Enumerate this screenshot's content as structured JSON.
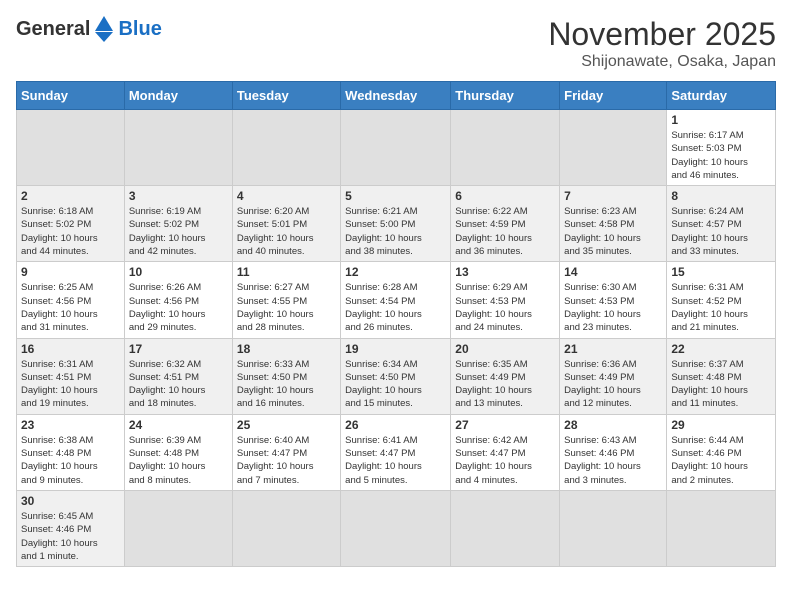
{
  "logo": {
    "general": "General",
    "blue": "Blue"
  },
  "title": "November 2025",
  "location": "Shijonawate, Osaka, Japan",
  "days_of_week": [
    "Sunday",
    "Monday",
    "Tuesday",
    "Wednesday",
    "Thursday",
    "Friday",
    "Saturday"
  ],
  "weeks": [
    [
      {
        "day": "",
        "info": ""
      },
      {
        "day": "",
        "info": ""
      },
      {
        "day": "",
        "info": ""
      },
      {
        "day": "",
        "info": ""
      },
      {
        "day": "",
        "info": ""
      },
      {
        "day": "",
        "info": ""
      },
      {
        "day": "1",
        "info": "Sunrise: 6:17 AM\nSunset: 5:03 PM\nDaylight: 10 hours\nand 46 minutes."
      }
    ],
    [
      {
        "day": "2",
        "info": "Sunrise: 6:18 AM\nSunset: 5:02 PM\nDaylight: 10 hours\nand 44 minutes."
      },
      {
        "day": "3",
        "info": "Sunrise: 6:19 AM\nSunset: 5:02 PM\nDaylight: 10 hours\nand 42 minutes."
      },
      {
        "day": "4",
        "info": "Sunrise: 6:20 AM\nSunset: 5:01 PM\nDaylight: 10 hours\nand 40 minutes."
      },
      {
        "day": "5",
        "info": "Sunrise: 6:21 AM\nSunset: 5:00 PM\nDaylight: 10 hours\nand 38 minutes."
      },
      {
        "day": "6",
        "info": "Sunrise: 6:22 AM\nSunset: 4:59 PM\nDaylight: 10 hours\nand 36 minutes."
      },
      {
        "day": "7",
        "info": "Sunrise: 6:23 AM\nSunset: 4:58 PM\nDaylight: 10 hours\nand 35 minutes."
      },
      {
        "day": "8",
        "info": "Sunrise: 6:24 AM\nSunset: 4:57 PM\nDaylight: 10 hours\nand 33 minutes."
      }
    ],
    [
      {
        "day": "9",
        "info": "Sunrise: 6:25 AM\nSunset: 4:56 PM\nDaylight: 10 hours\nand 31 minutes."
      },
      {
        "day": "10",
        "info": "Sunrise: 6:26 AM\nSunset: 4:56 PM\nDaylight: 10 hours\nand 29 minutes."
      },
      {
        "day": "11",
        "info": "Sunrise: 6:27 AM\nSunset: 4:55 PM\nDaylight: 10 hours\nand 28 minutes."
      },
      {
        "day": "12",
        "info": "Sunrise: 6:28 AM\nSunset: 4:54 PM\nDaylight: 10 hours\nand 26 minutes."
      },
      {
        "day": "13",
        "info": "Sunrise: 6:29 AM\nSunset: 4:53 PM\nDaylight: 10 hours\nand 24 minutes."
      },
      {
        "day": "14",
        "info": "Sunrise: 6:30 AM\nSunset: 4:53 PM\nDaylight: 10 hours\nand 23 minutes."
      },
      {
        "day": "15",
        "info": "Sunrise: 6:31 AM\nSunset: 4:52 PM\nDaylight: 10 hours\nand 21 minutes."
      }
    ],
    [
      {
        "day": "16",
        "info": "Sunrise: 6:31 AM\nSunset: 4:51 PM\nDaylight: 10 hours\nand 19 minutes."
      },
      {
        "day": "17",
        "info": "Sunrise: 6:32 AM\nSunset: 4:51 PM\nDaylight: 10 hours\nand 18 minutes."
      },
      {
        "day": "18",
        "info": "Sunrise: 6:33 AM\nSunset: 4:50 PM\nDaylight: 10 hours\nand 16 minutes."
      },
      {
        "day": "19",
        "info": "Sunrise: 6:34 AM\nSunset: 4:50 PM\nDaylight: 10 hours\nand 15 minutes."
      },
      {
        "day": "20",
        "info": "Sunrise: 6:35 AM\nSunset: 4:49 PM\nDaylight: 10 hours\nand 13 minutes."
      },
      {
        "day": "21",
        "info": "Sunrise: 6:36 AM\nSunset: 4:49 PM\nDaylight: 10 hours\nand 12 minutes."
      },
      {
        "day": "22",
        "info": "Sunrise: 6:37 AM\nSunset: 4:48 PM\nDaylight: 10 hours\nand 11 minutes."
      }
    ],
    [
      {
        "day": "23",
        "info": "Sunrise: 6:38 AM\nSunset: 4:48 PM\nDaylight: 10 hours\nand 9 minutes."
      },
      {
        "day": "24",
        "info": "Sunrise: 6:39 AM\nSunset: 4:48 PM\nDaylight: 10 hours\nand 8 minutes."
      },
      {
        "day": "25",
        "info": "Sunrise: 6:40 AM\nSunset: 4:47 PM\nDaylight: 10 hours\nand 7 minutes."
      },
      {
        "day": "26",
        "info": "Sunrise: 6:41 AM\nSunset: 4:47 PM\nDaylight: 10 hours\nand 5 minutes."
      },
      {
        "day": "27",
        "info": "Sunrise: 6:42 AM\nSunset: 4:47 PM\nDaylight: 10 hours\nand 4 minutes."
      },
      {
        "day": "28",
        "info": "Sunrise: 6:43 AM\nSunset: 4:46 PM\nDaylight: 10 hours\nand 3 minutes."
      },
      {
        "day": "29",
        "info": "Sunrise: 6:44 AM\nSunset: 4:46 PM\nDaylight: 10 hours\nand 2 minutes."
      }
    ],
    [
      {
        "day": "30",
        "info": "Sunrise: 6:45 AM\nSunset: 4:46 PM\nDaylight: 10 hours\nand 1 minute."
      },
      {
        "day": "",
        "info": ""
      },
      {
        "day": "",
        "info": ""
      },
      {
        "day": "",
        "info": ""
      },
      {
        "day": "",
        "info": ""
      },
      {
        "day": "",
        "info": ""
      },
      {
        "day": "",
        "info": ""
      }
    ]
  ]
}
